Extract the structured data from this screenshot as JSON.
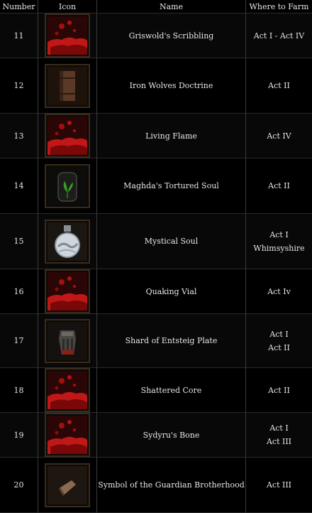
{
  "headers": {
    "number": "Number",
    "icon": "Icon",
    "name": "Name",
    "farm": "Where to Farm"
  },
  "rows": [
    {
      "number": "11",
      "icon": "blood-splatter-icon",
      "name": "Griswold's Scribbling",
      "farm1": "Act I - Act IV",
      "farm2": ""
    },
    {
      "number": "12",
      "icon": "tome-icon",
      "name": "Iron Wolves Doctrine",
      "farm1": "Act II",
      "farm2": ""
    },
    {
      "number": "13",
      "icon": "blood-splatter-icon",
      "name": "Living Flame",
      "farm1": "Act IV",
      "farm2": ""
    },
    {
      "number": "14",
      "icon": "soul-jar-icon",
      "name": "Maghda's Tortured Soul",
      "farm1": "Act II",
      "farm2": ""
    },
    {
      "number": "15",
      "icon": "potion-flask-icon",
      "name": "Mystical Soul",
      "farm1": "Act I",
      "farm2": "Whimsyshire"
    },
    {
      "number": "16",
      "icon": "blood-splatter-icon",
      "name": "Quaking Vial",
      "farm1": "Act Iv",
      "farm2": ""
    },
    {
      "number": "17",
      "icon": "gauntlet-icon",
      "name": "Shard of Entsteig Plate",
      "farm1": "Act I",
      "farm2": "Act II"
    },
    {
      "number": "18",
      "icon": "blood-splatter-icon",
      "name": "Shattered Core",
      "farm1": "Act II",
      "farm2": ""
    },
    {
      "number": "19",
      "icon": "blood-splatter-icon",
      "name": "Sydyru's Bone",
      "farm1": "Act I",
      "farm2": "Act III"
    },
    {
      "number": "20",
      "icon": "scroll-icon",
      "name": "Symbol of the Guardian Brotherhood",
      "farm1": "Act III",
      "farm2": ""
    }
  ]
}
